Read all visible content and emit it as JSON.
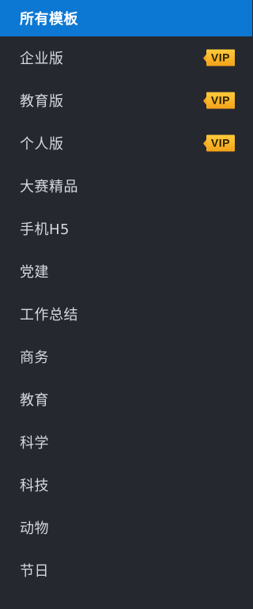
{
  "sidebar": {
    "items": [
      {
        "label": "所有模板",
        "active": true
      },
      {
        "label": "企业版",
        "vip": "VIP"
      },
      {
        "label": "教育版",
        "vip": "VIP"
      },
      {
        "label": "个人版",
        "vip": "VIP"
      },
      {
        "label": "大赛精品"
      },
      {
        "label": "手机H5"
      },
      {
        "label": "党建"
      },
      {
        "label": "工作总结"
      },
      {
        "label": "商务"
      },
      {
        "label": "教育"
      },
      {
        "label": "科学"
      },
      {
        "label": "科技"
      },
      {
        "label": "动物"
      },
      {
        "label": "节日"
      }
    ]
  },
  "colors": {
    "background": "#262830",
    "active_background": "#0d78d3",
    "text": "#d7d9de",
    "vip_badge": "#f5a51c"
  }
}
